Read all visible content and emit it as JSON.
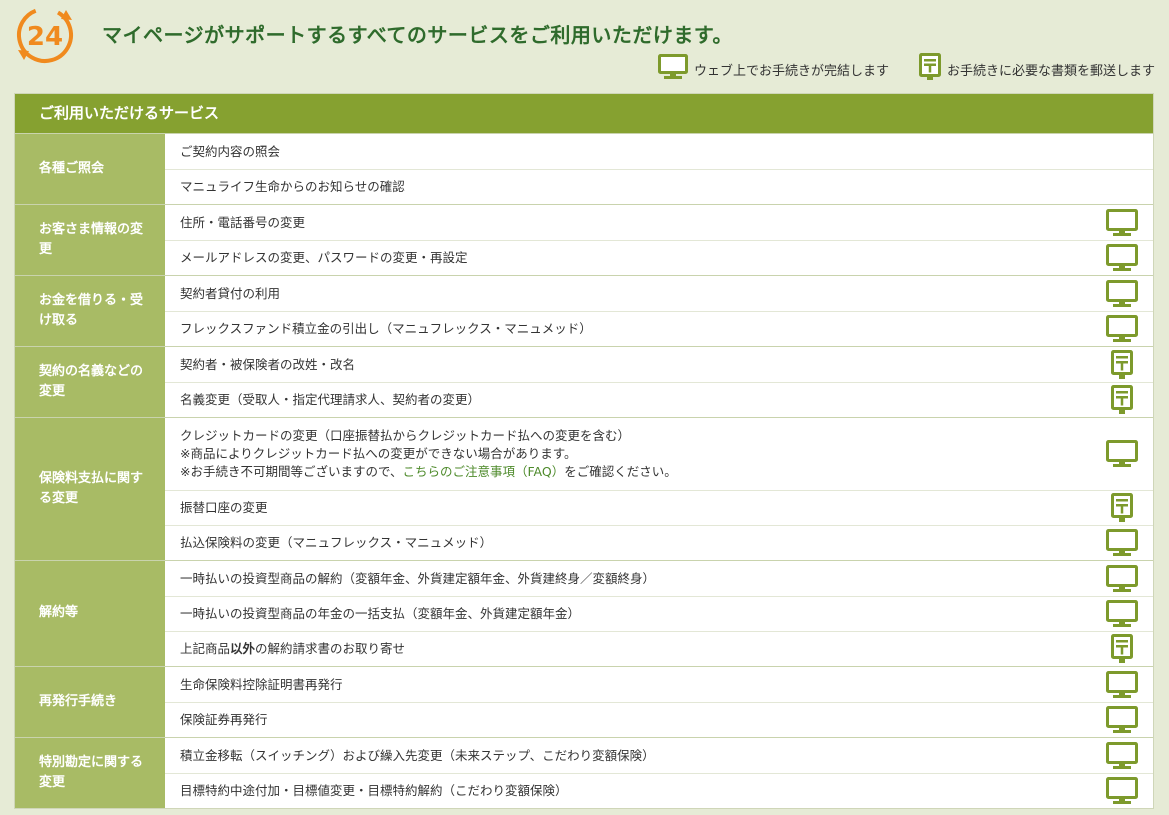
{
  "header": {
    "badge_text": "24",
    "headline": "マイページがサポートするすべてのサービスをご利用いただけます。",
    "legend": [
      {
        "icon": "monitor-icon",
        "label": "ウェブ上でお手続きが完結します"
      },
      {
        "icon": "postbox-icon",
        "label": "お手続きに必要な書類を郵送します"
      }
    ]
  },
  "colors": {
    "accent_green": "#86a130",
    "category_green": "#a8bb65",
    "headline_green": "#2f6b2c",
    "badge_orange": "#f08a1e",
    "page_bg": "#e6ebd6"
  },
  "table": {
    "title": "ご利用いただけるサービス",
    "groups": [
      {
        "category": "各種ご照会",
        "items": [
          {
            "text": "ご契約内容の照会",
            "icon": ""
          },
          {
            "text": "マニュライフ生命からのお知らせの確認",
            "icon": ""
          }
        ]
      },
      {
        "category": "お客さま情報の変更",
        "items": [
          {
            "text": "住所・電話番号の変更",
            "icon": "monitor-icon"
          },
          {
            "text": "メールアドレスの変更、パスワードの変更・再設定",
            "icon": "monitor-icon"
          }
        ]
      },
      {
        "category": "お金を借りる・受け取る",
        "items": [
          {
            "text": "契約者貸付の利用",
            "icon": "monitor-icon"
          },
          {
            "text": "フレックスファンド積立金の引出し（マニュフレックス・マニュメッド）",
            "icon": "monitor-icon"
          }
        ]
      },
      {
        "category": "契約の名義などの変更",
        "items": [
          {
            "text": "契約者・被保険者の改姓・改名",
            "icon": "postbox-icon"
          },
          {
            "text": "名義変更（受取人・指定代理請求人、契約者の変更）",
            "icon": "postbox-icon"
          }
        ]
      },
      {
        "category": "保険料支払に関する変更",
        "items": [
          {
            "text": "クレジットカードの変更（口座振替払からクレジットカード払への変更を含む）",
            "note1": "※商品によりクレジットカード払への変更ができない場合があります。",
            "note2_prefix": "※お手続き不可期間等ございますので、",
            "note2_link": "こちらのご注意事項（FAQ）",
            "note2_suffix": "をご確認ください。",
            "icon": "monitor-icon"
          },
          {
            "text": "振替口座の変更",
            "icon": "postbox-icon"
          },
          {
            "text": "払込保険料の変更（マニュフレックス・マニュメッド）",
            "icon": "monitor-icon"
          }
        ]
      },
      {
        "category": "解約等",
        "items": [
          {
            "text": "一時払いの投資型商品の解約（変額年金、外貨建定額年金、外貨建終身／変額終身）",
            "icon": "monitor-icon"
          },
          {
            "text": "一時払いの投資型商品の年金の一括支払（変額年金、外貨建定額年金）",
            "icon": "monitor-icon"
          },
          {
            "text_prefix": "上記商品",
            "text_bold": "以外",
            "text_suffix": "の解約請求書のお取り寄せ",
            "icon": "postbox-icon"
          }
        ]
      },
      {
        "category": "再発行手続き",
        "items": [
          {
            "text": "生命保険料控除証明書再発行",
            "icon": "monitor-icon"
          },
          {
            "text": "保険証券再発行",
            "icon": "monitor-icon"
          }
        ]
      },
      {
        "category": "特別勘定に関する変更",
        "items": [
          {
            "text": "積立金移転（スイッチング）および繰入先変更（未来ステップ、こだわり変額保険）",
            "icon": "monitor-icon"
          },
          {
            "text": "目標特約中途付加・目標値変更・目標特約解約（こだわり変額保険）",
            "icon": "monitor-icon"
          }
        ]
      }
    ]
  }
}
